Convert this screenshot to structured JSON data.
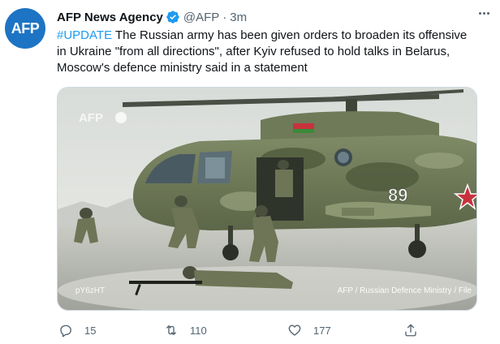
{
  "author": {
    "avatar_text": "AFP",
    "name": "AFP News Agency",
    "handle": "@AFP",
    "separator": "·",
    "time": "3m",
    "verified": true
  },
  "tweet": {
    "hashtag": "#UPDATE",
    "line1_rest": " The Russian army has been given orders to broaden its offensive",
    "line2": "in Ukraine \"from all directions\", after Kyiv refused to hold talks in Belarus,",
    "line3": "Moscow's defence ministry said in a statement"
  },
  "media": {
    "watermark": "AFP",
    "photo_code": "pY6zHT",
    "credit": "AFP / Russian Defence Ministry / File",
    "tail_number": "89"
  },
  "actions": {
    "reply_count": "15",
    "retweet_count": "110",
    "like_count": "177"
  },
  "colors": {
    "accent": "#1d9bf0",
    "avatar_bg": "#1d74c4",
    "muted": "#536471"
  }
}
